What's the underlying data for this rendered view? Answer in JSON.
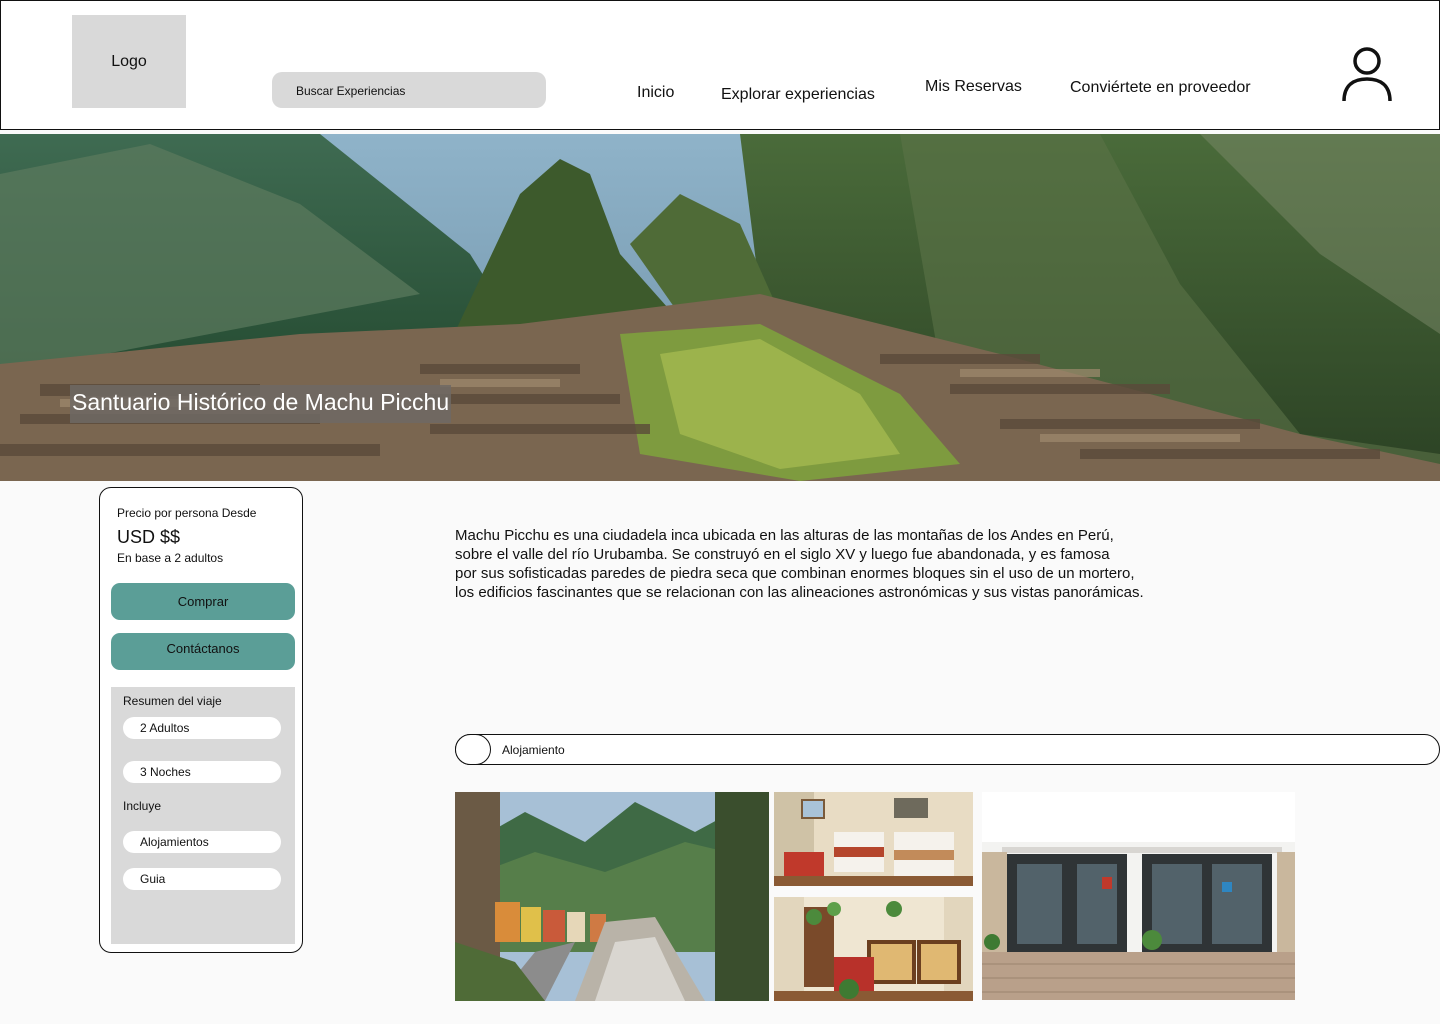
{
  "header": {
    "logo": "Logo",
    "search_placeholder": "Buscar Experiencias",
    "nav": [
      "Inicio",
      "Explorar experiencias",
      "Mis Reservas",
      "Conviértete en proveedor"
    ]
  },
  "hero": {
    "title": "Santuario Histórico de Machu Picchu"
  },
  "price_card": {
    "label": "Precio por persona Desde",
    "value": "USD $$",
    "base": "En base a 2 adultos",
    "buy_button": "Comprar",
    "contact_button": "Contáctanos",
    "summary": {
      "title": "Resumen del viaje",
      "items": [
        "2 Adultos",
        "3 Noches"
      ],
      "includes_title": "Incluye",
      "includes": [
        "Alojamientos",
        "Guia"
      ]
    }
  },
  "description": [
    "Machu Picchu es una ciudadela inca ubicada en las alturas de las montañas de los Andes en Perú,",
    " sobre el valle del río Urubamba. Se construyó en el siglo XV y luego fue abandonada, y es famosa",
    " por sus sofisticadas paredes de piedra seca que combinan enormes bloques sin el uso de un mortero,",
    " los edificios fascinantes que se relacionan con las alineaciones astronómicas y sus vistas panorámicas."
  ],
  "accordion": {
    "label": "Alojamiento"
  },
  "colors": {
    "accent_button": "#5b9e97",
    "placeholder_gray": "#d9d9d9",
    "hero_title_bg": "#6e6964"
  },
  "icons": [
    "user-icon",
    "toggle-icon"
  ]
}
